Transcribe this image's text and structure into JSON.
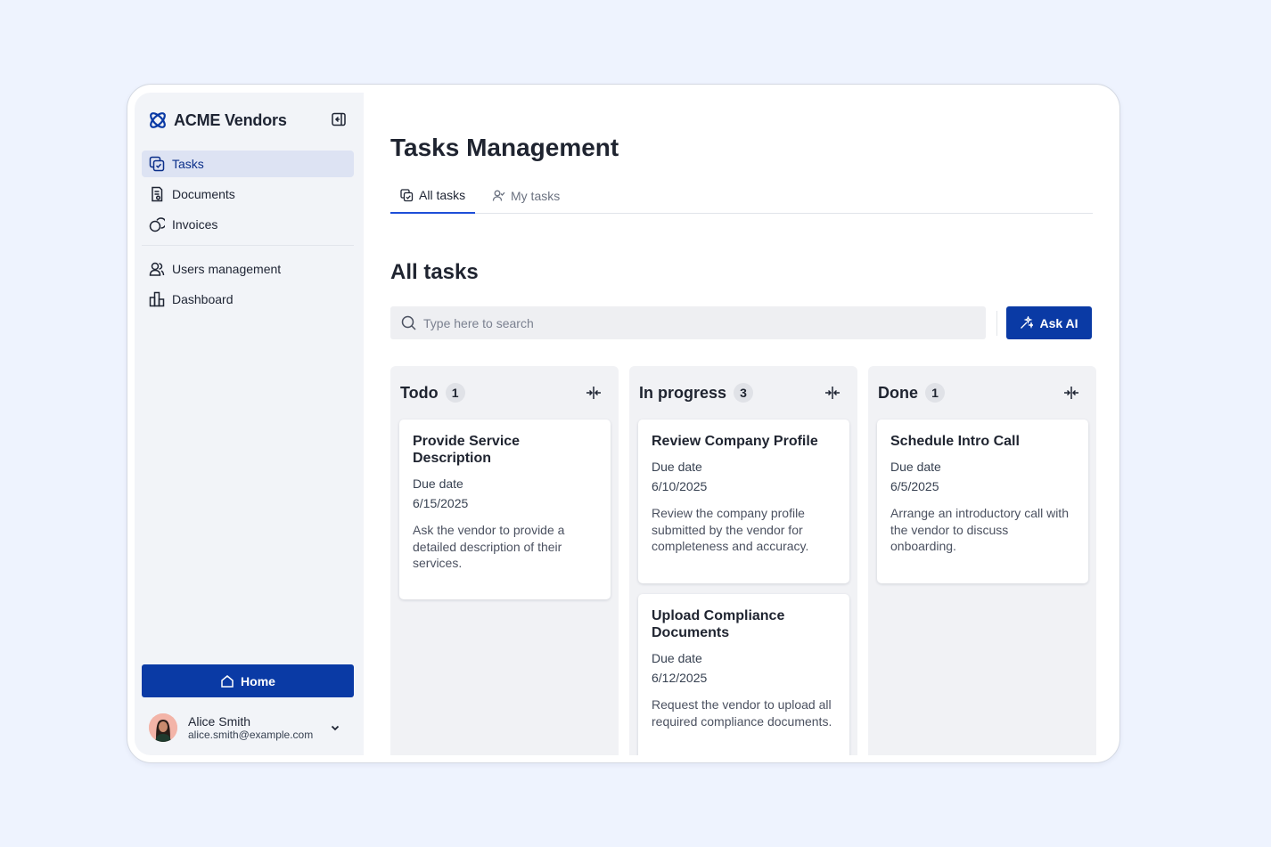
{
  "sidebar": {
    "brand": "ACME Vendors",
    "nav_primary": [
      {
        "label": "Tasks",
        "icon": "tasks-icon",
        "active": true
      },
      {
        "label": "Documents",
        "icon": "documents-icon",
        "active": false
      },
      {
        "label": "Invoices",
        "icon": "invoices-icon",
        "active": false
      }
    ],
    "nav_secondary": [
      {
        "label": "Users management",
        "icon": "users-icon",
        "active": false
      },
      {
        "label": "Dashboard",
        "icon": "dashboard-icon",
        "active": false
      }
    ],
    "home_label": "Home",
    "user": {
      "name": "Alice Smith",
      "email": "alice.smith@example.com"
    }
  },
  "main": {
    "page_title": "Tasks Management",
    "tabs": [
      {
        "label": "All tasks",
        "active": true
      },
      {
        "label": "My tasks",
        "active": false
      }
    ],
    "section_title": "All tasks",
    "search": {
      "placeholder": "Type here to search",
      "value": ""
    },
    "ask_ai_label": "Ask AI"
  },
  "board": {
    "columns": [
      {
        "title": "Todo",
        "count": "1",
        "cards": [
          {
            "title": "Provide Service Description",
            "due_label": "Due date",
            "due_date": "6/15/2025",
            "description": "Ask the vendor to provide a detailed description of their services."
          }
        ]
      },
      {
        "title": "In progress",
        "count": "3",
        "cards": [
          {
            "title": "Review Company Profile",
            "due_label": "Due date",
            "due_date": "6/10/2025",
            "description": "Review the company profile submitted by the vendor for completeness and accuracy."
          },
          {
            "title": "Upload Compliance Documents",
            "due_label": "Due date",
            "due_date": "6/12/2025",
            "description": "Request the vendor to upload all required compliance documents."
          }
        ]
      },
      {
        "title": "Done",
        "count": "1",
        "cards": [
          {
            "title": "Schedule Intro Call",
            "due_label": "Due date",
            "due_date": "6/5/2025",
            "description": "Arrange an introductory call with the vendor to discuss onboarding."
          }
        ]
      }
    ]
  },
  "colors": {
    "accent": "#0a3aa5",
    "background": "#eef3fe",
    "sidebar": "#f2f4f8",
    "column": "#f1f2f5"
  }
}
